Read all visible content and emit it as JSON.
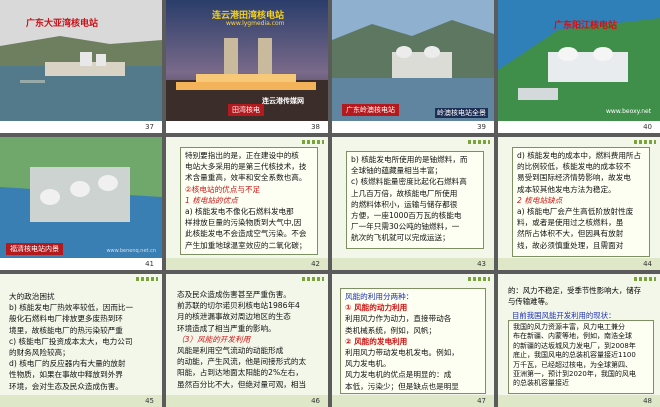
{
  "slides": [
    {
      "number": "37",
      "caption": "广东大亚湾核电站"
    },
    {
      "number": "38",
      "caption": "连云港田湾核电站",
      "url": "www.lygmedia.com",
      "badge": "连云港传媒网",
      "site_label": "田湾核电"
    },
    {
      "number": "39",
      "caption": "广东岭澳核电站",
      "sub_caption": "岭澳核电站全景"
    },
    {
      "number": "40",
      "caption": "广东阳江核电站",
      "watermark": "www.beoxy.net"
    },
    {
      "number": "41",
      "caption": "福清核电站内景",
      "url": "www.benenq.net.cn"
    },
    {
      "number": "42",
      "lines": [
        "特别要指出的是，正在建设中的核",
        "电站大多采用的是第三代核技术，技",
        "术含量重高，效率和安全系数也高。"
      ],
      "heading": "②核电站的优点与不足",
      "sub_heading": "1 核电站的优点",
      "para": [
        "a) 核能发电不像化石燃料发电那",
        "样排放巨量的污染物质到大气中,因",
        "此核能发电不会造成空气污染。不会",
        "产生加重地球温室效应的二氧化碳；"
      ]
    },
    {
      "number": "43",
      "lines": [
        "b) 核能发电所使用的是铀燃料，而",
        "全球铀的蕴藏量相当丰富；",
        "c) 核燃料能量密度比起化石燃料高",
        "上几百万倍，故核能电厂所使用",
        "的燃料体积小，运输与储存都很",
        "方便，一座1000百万瓦的核能电",
        "厂一年只需30公吨的铀燃料，一",
        "航次的飞机就可以完成运送；"
      ]
    },
    {
      "number": "44",
      "lines": [
        "d) 核能发电的成本中，燃料费用所占",
        "的比例较低，核能发电的成本较不",
        "易受到国际经济情势影响，故发电",
        "成本较其他发电方法为稳定。"
      ],
      "sub_heading": "2 核电站缺点",
      "para": [
        "a) 核能电厂会产生高低阶放射性废",
        "料，或者是使用过之核燃料，虽",
        "然所占体积不大，但因具有放射",
        "线，故必须慎重处理，且需面对"
      ]
    },
    {
      "number": "45",
      "lines": [
        "大的政治困扰",
        "b) 核能发电厂热效率较低，因而比一",
        "般化石燃料电厂排放更多废热到环",
        "境里，故核能电厂的热污染较严重",
        "c) 核能电厂投资成本太大，电力公司",
        "的财务风险较高；",
        "d) 核电厂的反应器内有大量的放射",
        "性物质，如果在事故中释放到外界",
        "环境，会对生态及民众造成伤害。"
      ]
    },
    {
      "number": "46",
      "lines": [
        "态及民众造成伤害甚至严重伤害。",
        "前苏联的切尔诺贝利核电站1986年4",
        "月的核泄漏事故对周边地区的生态",
        "环境造成了相当严重的影响。"
      ],
      "heading": "（3）风能的开发利用",
      "para": [
        "风能是利用空气流动的动能形成",
        "的动能，产生风流，他是间接形式的太",
        "阳能，占到达地面太阳能的2%左右，",
        "虽然百分比不大，但绝对量可观，相当",
        "于10300亿吨煤蕴藏的能量。"
      ]
    },
    {
      "number": "47",
      "heading": "风能的利用分两种：",
      "item1": "① 风能的动力利用",
      "item1_text": [
        "利用风力作为动力，直接带动各",
        "类机械系统，例如，风帆；"
      ],
      "item2": "② 风能的发电利用",
      "item2_text": [
        "利用风力带动发电机发电。例如，",
        "风力发电机。",
        "风力发电机的优点是明显的：成",
        "本低，污染少；但是缺点也是明显"
      ]
    },
    {
      "number": "48",
      "lines": [
        "的：风力不稳定，受季节性影响大，储存",
        "与传输难等。"
      ],
      "heading": "目前我国风能开发利用的现状：",
      "para": [
        "我国的风力资源丰富，风力电工兼分",
        "布在新疆、内蒙等地，例如，南浩全球",
        "的新疆的达坂城风力发电厂，到2008年",
        "底止，我国风电的总装机容量接近1100",
        "万千瓦，已经超过核电，为全球第四、",
        "亚洲第一，预计到2020年，我国的风电",
        "的总装机容量接近"
      ]
    }
  ]
}
